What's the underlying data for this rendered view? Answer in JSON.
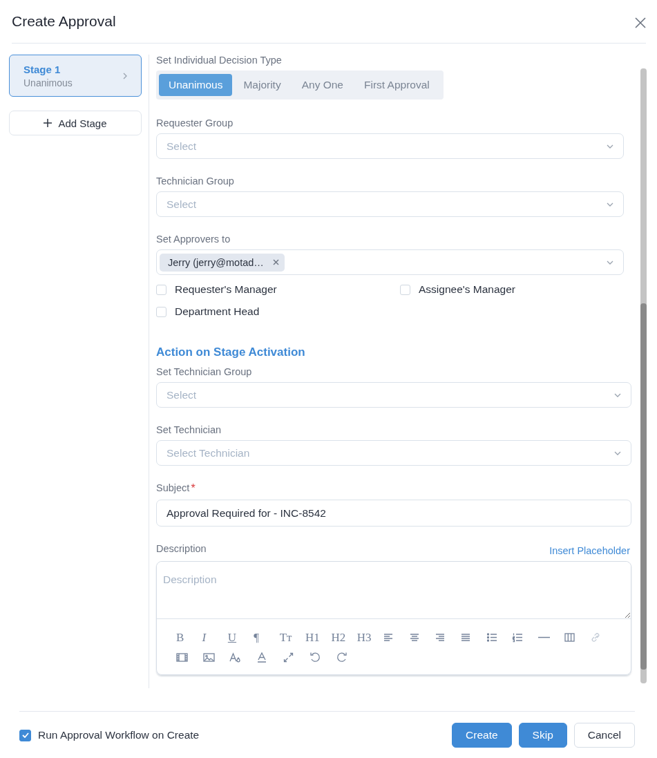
{
  "dialog": {
    "title": "Create Approval"
  },
  "stages": [
    {
      "title": "Stage 1",
      "subtitle": "Unanimous",
      "selected": true
    }
  ],
  "add_stage": "Add Stage",
  "decision_type": {
    "label": "Set Individual Decision Type",
    "options": [
      {
        "label": "Unanimous",
        "selected": true
      },
      {
        "label": "Majority",
        "selected": false
      },
      {
        "label": "Any One",
        "selected": false
      },
      {
        "label": "First Approval",
        "selected": false
      }
    ]
  },
  "fields": [
    {
      "kind": "select",
      "label": "Requester Group",
      "placeholder": "Select"
    },
    {
      "kind": "select",
      "label": "Technician Group",
      "placeholder": "Select"
    },
    {
      "kind": "tags",
      "label": "Set Approvers to",
      "tags": [
        "Jerry (jerry@motad…"
      ]
    }
  ],
  "checkboxes": [
    {
      "label": "Requester's Manager",
      "checked": false
    },
    {
      "label": "Assignee's Manager",
      "checked": false
    },
    {
      "label": "Department Head",
      "checked": false
    }
  ],
  "section_title": "Action on Stage Activation",
  "action_fields": [
    {
      "kind": "select",
      "label": "Set Technician Group",
      "placeholder": "Select"
    },
    {
      "kind": "select",
      "label": "Set Technician",
      "placeholder": "Select Technician"
    },
    {
      "kind": "text",
      "label": "Subject",
      "required_mark": "*",
      "value": "Approval Required for - INC-8542"
    }
  ],
  "description": {
    "label": "Description",
    "link": "Insert Placeholder",
    "placeholder": "Description",
    "toolbar": [
      [
        {
          "kind": "glyph",
          "label": "B"
        },
        {
          "kind": "glyph",
          "label": "I",
          "italic": true
        },
        {
          "kind": "glyph",
          "label": "U",
          "underline": true
        },
        {
          "kind": "glyph",
          "label": "¶"
        },
        {
          "kind": "glyph",
          "label": "Tт"
        },
        {
          "kind": "glyph",
          "label": "H1"
        },
        {
          "kind": "glyph",
          "label": "H2"
        },
        {
          "kind": "glyph",
          "label": "H3"
        },
        {
          "kind": "alignleft"
        },
        {
          "kind": "aligncenter"
        },
        {
          "kind": "alignright"
        },
        {
          "kind": "justify"
        },
        {
          "kind": "bullets"
        },
        {
          "kind": "numbered"
        },
        {
          "kind": "rule"
        },
        {
          "kind": "columns"
        },
        {
          "kind": "link",
          "disabled": true
        }
      ],
      [
        {
          "kind": "film"
        },
        {
          "kind": "image"
        },
        {
          "kind": "fontcolor"
        },
        {
          "kind": "underlinea"
        },
        {
          "kind": "expand"
        },
        {
          "kind": "undo"
        },
        {
          "kind": "redo"
        }
      ]
    ]
  },
  "footer": {
    "checkbox": {
      "label": "Run Approval Workflow on Create",
      "checked": true
    },
    "buttons": [
      {
        "label": "Create",
        "kind": "primary"
      },
      {
        "label": "Skip",
        "kind": "primary"
      },
      {
        "label": "Cancel",
        "kind": "secondary"
      }
    ]
  }
}
